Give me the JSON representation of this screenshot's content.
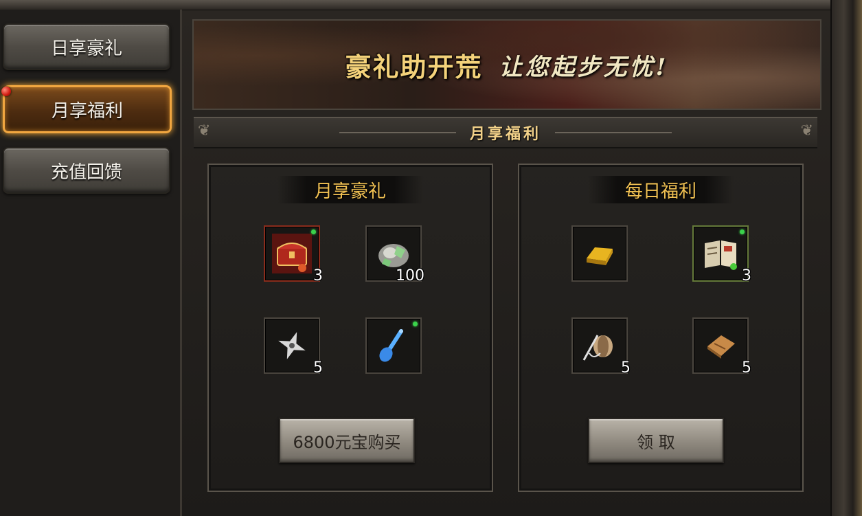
{
  "sidebar": {
    "items": [
      {
        "label": "日享豪礼",
        "active": false
      },
      {
        "label": "月享福利",
        "active": true
      },
      {
        "label": "充值回馈",
        "active": false
      }
    ]
  },
  "banner": {
    "title": "豪礼助开荒",
    "subtitle": "让您起步无忧!"
  },
  "section": {
    "title": "月享福利"
  },
  "monthly_panel": {
    "title": "月享豪礼",
    "items": [
      {
        "icon": "treasure-chest-icon",
        "count": "3"
      },
      {
        "icon": "silver-ore-icon",
        "count": "100"
      },
      {
        "icon": "shuriken-icon",
        "count": "5"
      },
      {
        "icon": "blue-flute-icon",
        "count": ""
      }
    ],
    "button_label": "6800元宝购买"
  },
  "daily_panel": {
    "title": "每日福利",
    "items": [
      {
        "icon": "gold-bar-icon",
        "count": ""
      },
      {
        "icon": "book-icon",
        "count": "3"
      },
      {
        "icon": "needle-thread-icon",
        "count": "5"
      },
      {
        "icon": "scroll-icon",
        "count": "5"
      }
    ],
    "button_label": "领 取"
  },
  "colors": {
    "accent_gold": "#f2c253",
    "active_border": "#f1a640",
    "panel_bg": "#1e1c1a"
  }
}
